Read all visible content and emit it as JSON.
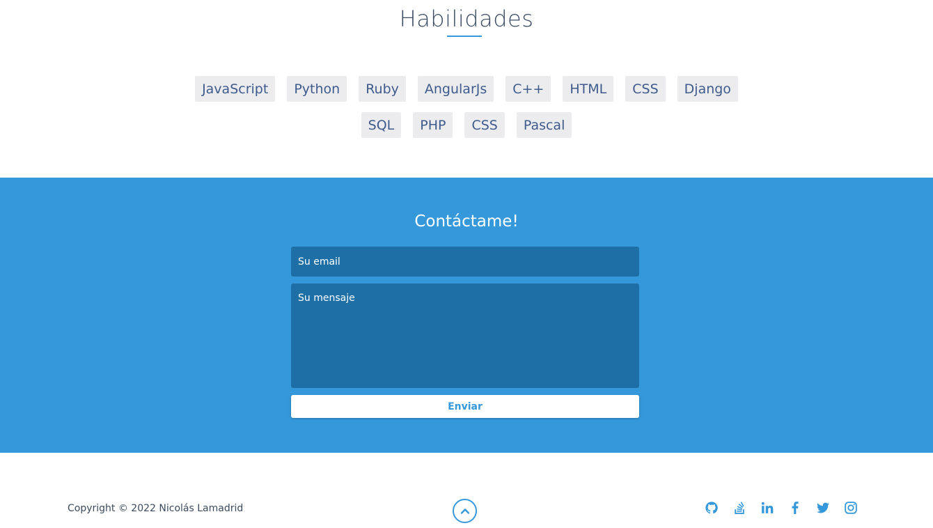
{
  "skills": {
    "title": "Habilidades",
    "row1": [
      "JavaScript",
      "Python",
      "Ruby",
      "AngularJs",
      "C++",
      "HTML",
      "CSS",
      "Django"
    ],
    "row2": [
      "SQL",
      "PHP",
      "CSS",
      "Pascal"
    ]
  },
  "contact": {
    "title": "Contáctame!",
    "email_placeholder": "Su email",
    "message_placeholder": "Su mensaje",
    "send_label": "Enviar"
  },
  "footer": {
    "copyright": "Copyright © 2022 Nicolás Lamadrid",
    "scroll_top_icon": "chevron-up-circle-icon",
    "social_icons": [
      "github-icon",
      "stackoverflow-icon",
      "linkedin-icon",
      "facebook-icon",
      "twitter-icon",
      "instagram-icon"
    ]
  },
  "colors": {
    "accent": "#3498db",
    "field_bg": "#1f6fa7",
    "tag_bg": "#ecebee"
  }
}
